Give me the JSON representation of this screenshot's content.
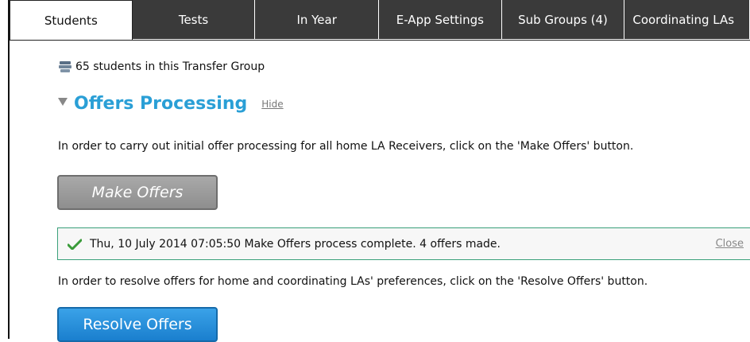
{
  "tabs": [
    {
      "label": "Students",
      "active": true
    },
    {
      "label": "Tests",
      "active": false
    },
    {
      "label": "In Year",
      "active": false
    },
    {
      "label": "E-App Settings",
      "active": false
    },
    {
      "label": "Sub Groups  (4)",
      "active": false
    },
    {
      "label": "Coordinating LAs",
      "active": false
    }
  ],
  "student_count_text": "65 students in this Transfer Group",
  "offers_section": {
    "title": "Offers Processing",
    "hide_label": "Hide",
    "make_offers_instruction": "In order to carry out initial offer processing for all home LA Receivers, click on the 'Make Offers' button.",
    "make_offers_button": "Make Offers",
    "notice": {
      "message": "Thu, 10 July 2014 07:05:50 Make Offers process complete. 4 offers made.",
      "close_label": "Close"
    },
    "resolve_offers_instruction": "In order to resolve offers for home and coordinating LAs' preferences, click on the 'Resolve Offers' button.",
    "resolve_offers_button": "Resolve Offers"
  },
  "colors": {
    "accent": "#2a9fd6",
    "tab_bg": "#3a3a3a",
    "notice_border": "#3aa07a",
    "resolve_button": "#1a7fce",
    "make_button": "#9a9a9a"
  },
  "icons": [
    "students-icon",
    "collapse-triangle-icon",
    "checkmark-icon"
  ]
}
